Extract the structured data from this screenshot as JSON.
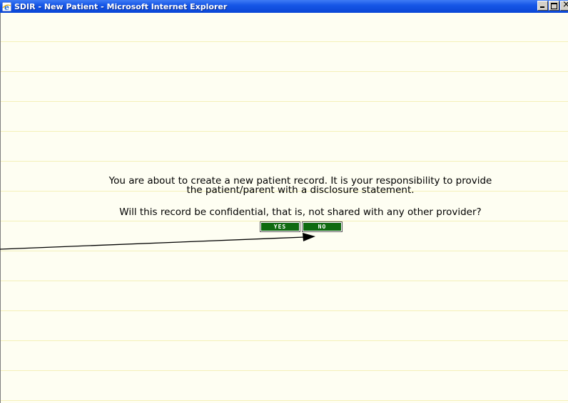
{
  "window": {
    "title": "SDIR - New Patient - Microsoft Internet Explorer",
    "icon": "internet-explorer-icon"
  },
  "message": {
    "line1": "You are about to create a new patient record. It is your responsibility to provide",
    "line2": "the patient/parent with a disclosure statement."
  },
  "question": "Will this record be confidential, that is, not shared with any other provider?",
  "buttons": {
    "yes_label": "YES",
    "no_label": "NO",
    "color": "#0f6a10"
  },
  "colors": {
    "background": "#fefef2",
    "rule_lines": "#f4f0b8",
    "titlebar": "#0a46d6"
  }
}
